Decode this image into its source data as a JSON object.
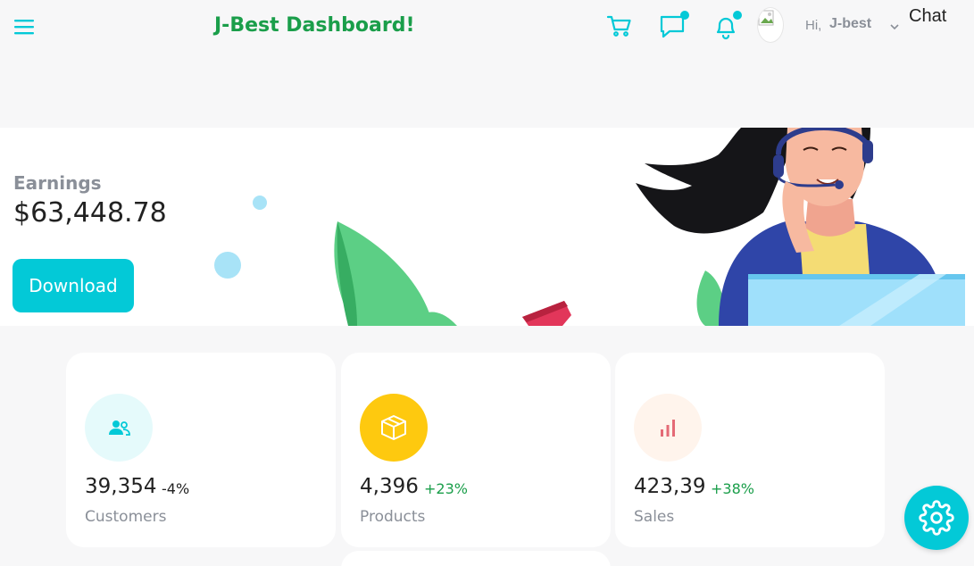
{
  "header": {
    "brand": "J-Best Dashboard!",
    "greeting": "Hi,",
    "username": "J-best",
    "chat_label": "Chat",
    "icons": [
      "menu-icon",
      "cart-icon",
      "chat-icon",
      "bell-icon",
      "chevron-down-icon"
    ]
  },
  "hero": {
    "label": "Earnings",
    "value": "$63,448.78",
    "button_label": "Download"
  },
  "cards": [
    {
      "value": "39,354",
      "change": "-4%",
      "title": "Customers",
      "icon": "users-icon",
      "icon_bg": "#e5fafb",
      "icon_color": "#03c9d7",
      "change_color": "#222222"
    },
    {
      "value": "4,396",
      "change": "+23%",
      "title": "Products",
      "icon": "box-icon",
      "icon_bg": "#fec90f",
      "icon_color": "#ffffff",
      "change_color": "#1a9e4a"
    },
    {
      "value": "423,39",
      "change": "+38%",
      "title": "Sales",
      "icon": "bar-chart-icon",
      "icon_bg": "#fff4ec",
      "icon_color": "#e46a76",
      "change_color": "#1a9e4a"
    }
  ],
  "colors": {
    "accent": "#03c9d7",
    "brand": "#1a9e4a",
    "muted": "#8a8f98"
  }
}
